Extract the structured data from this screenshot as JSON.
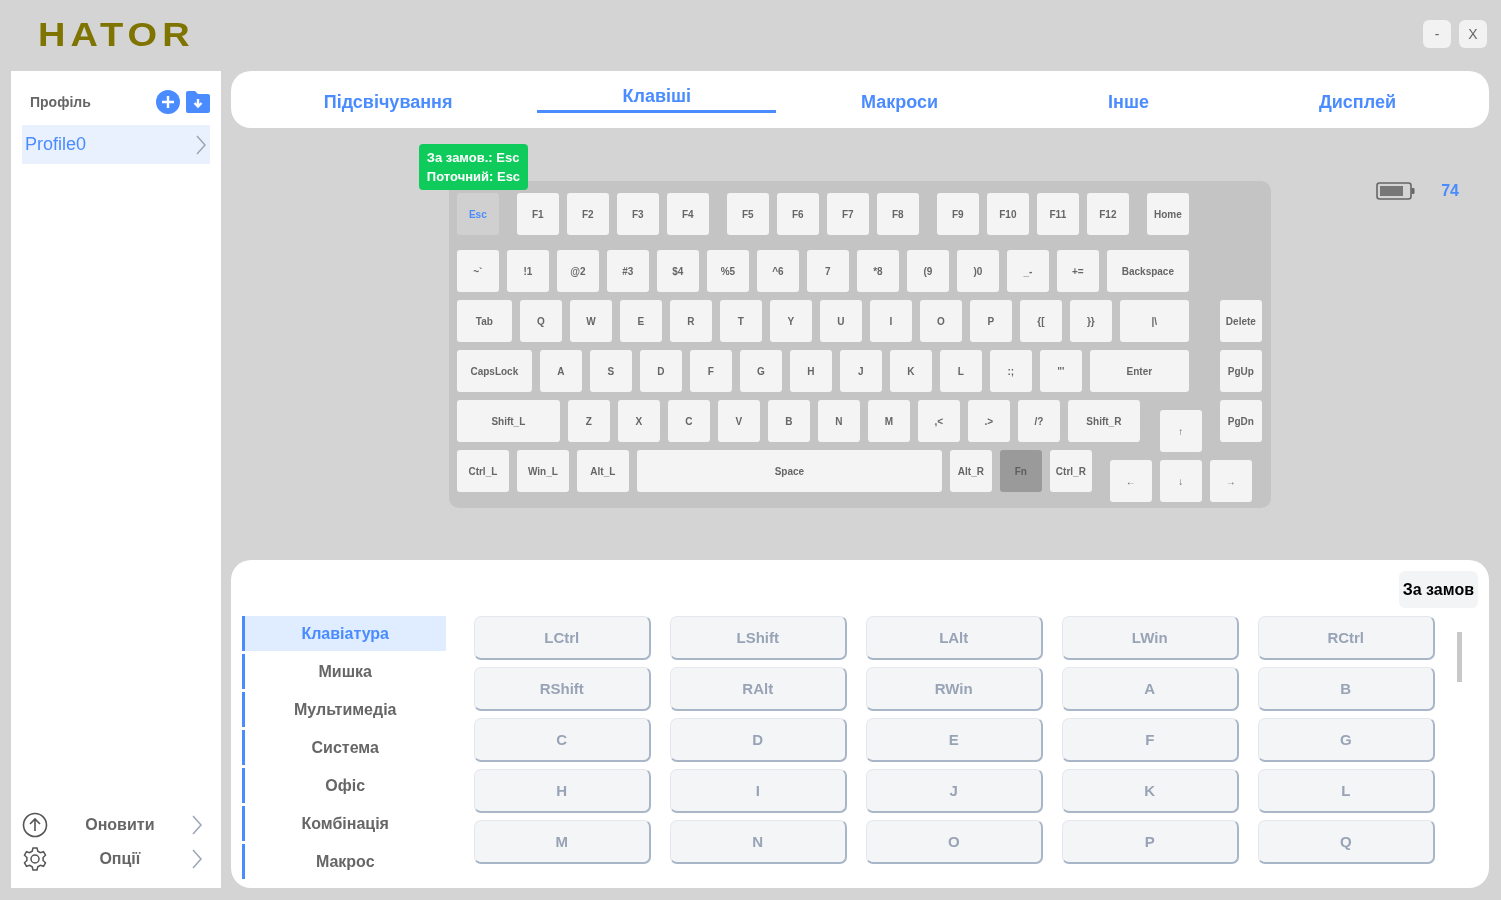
{
  "logo": "HATOR",
  "window_buttons": [
    "-",
    "X"
  ],
  "sidebar": {
    "title": "Профіль",
    "profiles": [
      {
        "label": "Profile0",
        "selected": true
      }
    ],
    "bottom_items": [
      {
        "kind": "update",
        "label": "Оновити"
      },
      {
        "kind": "options",
        "label": "Опції"
      }
    ]
  },
  "tabs": [
    {
      "label": "Підсвічування",
      "selected": false
    },
    {
      "label": "Клавіші",
      "selected": true
    },
    {
      "label": "Макроси",
      "selected": false
    },
    {
      "label": "Інше",
      "selected": false
    },
    {
      "label": "Дисплей",
      "selected": false
    }
  ],
  "tooltip": {
    "lines": [
      "За замов.: Esc",
      "Поточний: Esc"
    ]
  },
  "battery": {
    "reading": "74"
  },
  "keyboard": {
    "rows": [
      {
        "keys": [
          {
            "label": "Esc",
            "selected": true,
            "disabled": false
          },
          {
            "label": "F1",
            "selected": false,
            "disabled": false
          },
          {
            "label": "F2",
            "selected": false,
            "disabled": false
          },
          {
            "label": "F3",
            "selected": false,
            "disabled": false
          },
          {
            "label": "F4",
            "selected": false,
            "disabled": false
          },
          {
            "label": "F5",
            "selected": false,
            "disabled": false
          },
          {
            "label": "F6",
            "selected": false,
            "disabled": false
          },
          {
            "label": "F7",
            "selected": false,
            "disabled": false
          },
          {
            "label": "F8",
            "selected": false,
            "disabled": false
          },
          {
            "label": "F9",
            "selected": false,
            "disabled": false
          },
          {
            "label": "F10",
            "selected": false,
            "disabled": false
          },
          {
            "label": "F11",
            "selected": false,
            "disabled": false
          },
          {
            "label": "F12",
            "selected": false,
            "disabled": false
          },
          {
            "label": "Home",
            "selected": false,
            "disabled": false
          }
        ]
      },
      {
        "keys": [
          {
            "label": "~`",
            "selected": false,
            "disabled": false
          },
          {
            "label": "!1",
            "selected": false,
            "disabled": false
          },
          {
            "label": "@2",
            "selected": false,
            "disabled": false
          },
          {
            "label": "#3",
            "selected": false,
            "disabled": false
          },
          {
            "label": "$4",
            "selected": false,
            "disabled": false
          },
          {
            "label": "%5",
            "selected": false,
            "disabled": false
          },
          {
            "label": "^6",
            "selected": false,
            "disabled": false
          },
          {
            "label": "7",
            "selected": false,
            "disabled": false
          },
          {
            "label": "*8",
            "selected": false,
            "disabled": false
          },
          {
            "label": "(9",
            "selected": false,
            "disabled": false
          },
          {
            "label": ")0",
            "selected": false,
            "disabled": false
          },
          {
            "label": "_-",
            "selected": false,
            "disabled": false
          },
          {
            "label": "+=",
            "selected": false,
            "disabled": false
          },
          {
            "label": "Backspace",
            "selected": false,
            "disabled": false
          }
        ]
      },
      {
        "keys": [
          {
            "label": "Tab",
            "selected": false,
            "disabled": false
          },
          {
            "label": "Q",
            "selected": false,
            "disabled": false
          },
          {
            "label": "W",
            "selected": false,
            "disabled": false
          },
          {
            "label": "E",
            "selected": false,
            "disabled": false
          },
          {
            "label": "R",
            "selected": false,
            "disabled": false
          },
          {
            "label": "T",
            "selected": false,
            "disabled": false
          },
          {
            "label": "Y",
            "selected": false,
            "disabled": false
          },
          {
            "label": "U",
            "selected": false,
            "disabled": false
          },
          {
            "label": "I",
            "selected": false,
            "disabled": false
          },
          {
            "label": "O",
            "selected": false,
            "disabled": false
          },
          {
            "label": "P",
            "selected": false,
            "disabled": false
          },
          {
            "label": "{[",
            "selected": false,
            "disabled": false
          },
          {
            "label": "}}",
            "selected": false,
            "disabled": false
          },
          {
            "label": "|\\",
            "selected": false,
            "disabled": false
          },
          {
            "label": "Delete",
            "selected": false,
            "disabled": false
          }
        ]
      },
      {
        "keys": [
          {
            "label": "CapsLock",
            "selected": false,
            "disabled": false
          },
          {
            "label": "A",
            "selected": false,
            "disabled": false
          },
          {
            "label": "S",
            "selected": false,
            "disabled": false
          },
          {
            "label": "D",
            "selected": false,
            "disabled": false
          },
          {
            "label": "F",
            "selected": false,
            "disabled": false
          },
          {
            "label": "G",
            "selected": false,
            "disabled": false
          },
          {
            "label": "H",
            "selected": false,
            "disabled": false
          },
          {
            "label": "J",
            "selected": false,
            "disabled": false
          },
          {
            "label": "K",
            "selected": false,
            "disabled": false
          },
          {
            "label": "L",
            "selected": false,
            "disabled": false
          },
          {
            "label": ":;",
            "selected": false,
            "disabled": false
          },
          {
            "label": "\"'",
            "selected": false,
            "disabled": false
          },
          {
            "label": "Enter",
            "selected": false,
            "disabled": false
          },
          {
            "label": "PgUp",
            "selected": false,
            "disabled": false
          }
        ]
      },
      {
        "keys": [
          {
            "label": "Shift_L",
            "selected": false,
            "disabled": false
          },
          {
            "label": "Z",
            "selected": false,
            "disabled": false
          },
          {
            "label": "X",
            "selected": false,
            "disabled": false
          },
          {
            "label": "C",
            "selected": false,
            "disabled": false
          },
          {
            "label": "V",
            "selected": false,
            "disabled": false
          },
          {
            "label": "B",
            "selected": false,
            "disabled": false
          },
          {
            "label": "N",
            "selected": false,
            "disabled": false
          },
          {
            "label": "M",
            "selected": false,
            "disabled": false
          },
          {
            "label": ",<",
            "selected": false,
            "disabled": false
          },
          {
            "label": ".>",
            "selected": false,
            "disabled": false
          },
          {
            "label": "/?",
            "selected": false,
            "disabled": false
          },
          {
            "label": "Shift_R",
            "selected": false,
            "disabled": false
          },
          {
            "label": "↑",
            "selected": false,
            "disabled": false
          },
          {
            "label": "PgDn",
            "selected": false,
            "disabled": false
          }
        ]
      },
      {
        "keys": [
          {
            "label": "Ctrl_L",
            "selected": false,
            "disabled": false
          },
          {
            "label": "Win_L",
            "selected": false,
            "disabled": false
          },
          {
            "label": "Alt_L",
            "selected": false,
            "disabled": false
          },
          {
            "label": "Space",
            "selected": false,
            "disabled": false
          },
          {
            "label": "Alt_R",
            "selected": false,
            "disabled": false
          },
          {
            "label": "Fn",
            "selected": false,
            "disabled": true
          },
          {
            "label": "Ctrl_R",
            "selected": false,
            "disabled": false
          },
          {
            "label": "←",
            "selected": false,
            "disabled": false
          },
          {
            "label": "↓",
            "selected": false,
            "disabled": false
          },
          {
            "label": "→",
            "selected": false,
            "disabled": false
          }
        ]
      }
    ]
  },
  "key_picker": {
    "custom_button": "За замов",
    "categories": [
      {
        "label": "Клавіатура",
        "selected": true
      },
      {
        "label": "Мишка",
        "selected": false
      },
      {
        "label": "Мультимедіа",
        "selected": false
      },
      {
        "label": "Система",
        "selected": false
      },
      {
        "label": "Офіс",
        "selected": false
      },
      {
        "label": "Комбінація",
        "selected": false
      },
      {
        "label": "Макрос",
        "selected": false
      }
    ],
    "keys": [
      "LCtrl",
      "LShift",
      "LAlt",
      "LWin",
      "RCtrl",
      "RShift",
      "RAlt",
      "RWin",
      "A",
      "B",
      "C",
      "D",
      "E",
      "F",
      "G",
      "H",
      "I",
      "J",
      "K",
      "L",
      "M",
      "N",
      "O",
      "P",
      "Q"
    ]
  }
}
